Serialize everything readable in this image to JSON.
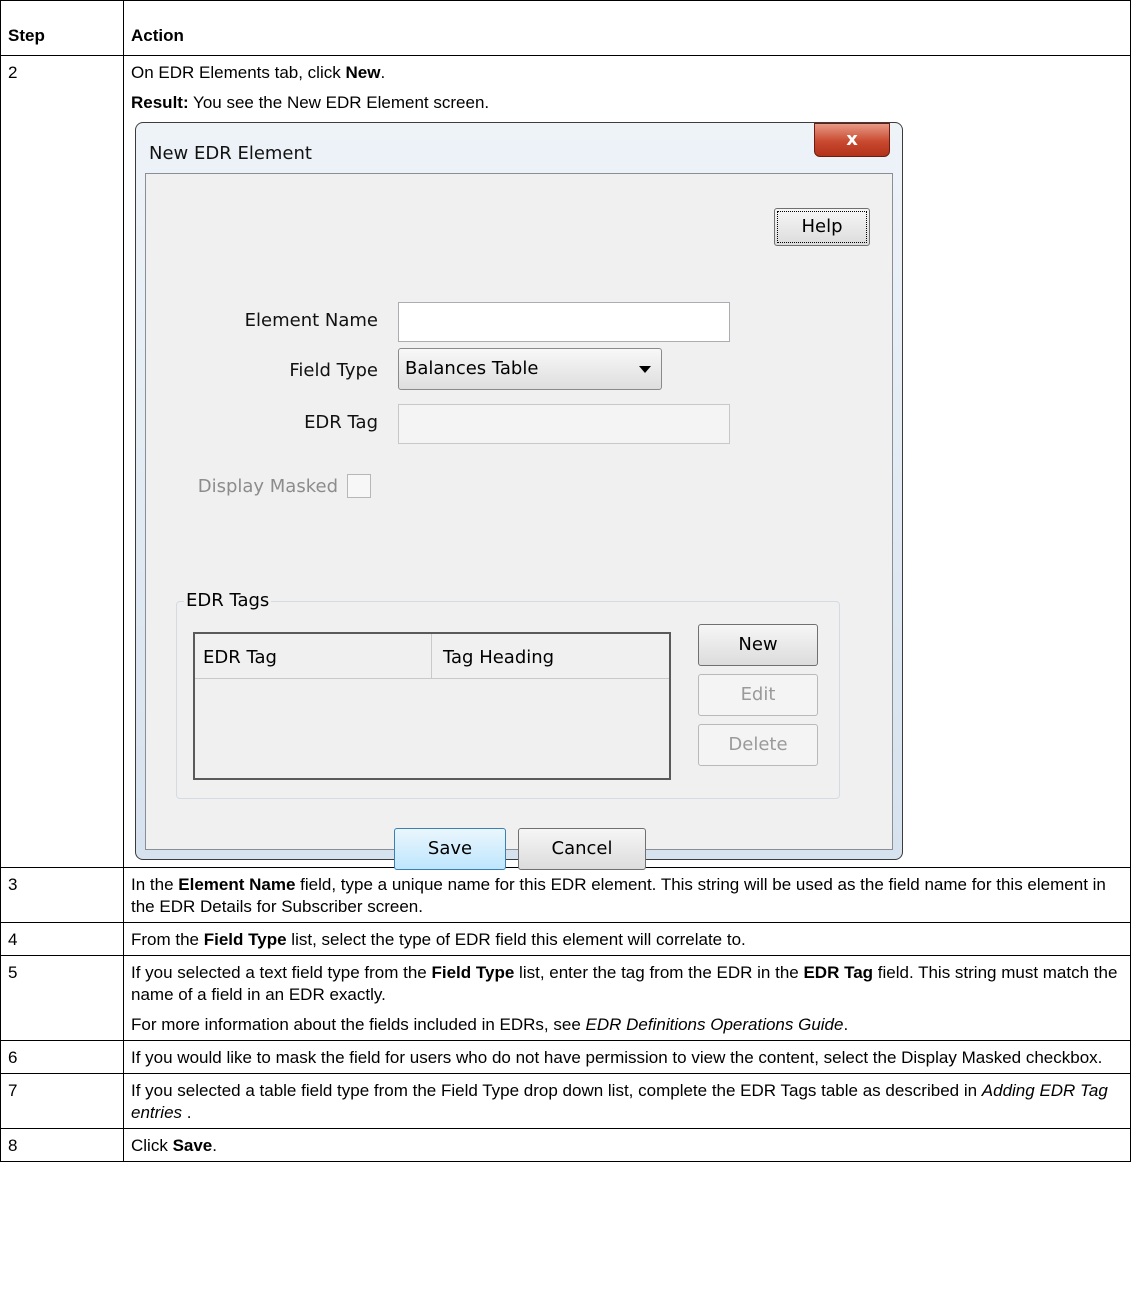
{
  "table": {
    "headers": [
      "Step",
      "Action"
    ],
    "rows": [
      {
        "step": "2",
        "parts": [
          [
            {
              "t": "On EDR Elements tab, click "
            },
            {
              "t": "New",
              "b": true
            },
            {
              "t": "."
            }
          ],
          [
            {
              "t": "Result:",
              "b": true
            },
            {
              "t": " You see the New EDR Element screen."
            }
          ]
        ],
        "has_dialog": true
      },
      {
        "step": "3",
        "parts": [
          [
            {
              "t": "In the "
            },
            {
              "t": "Element Name",
              "b": true
            },
            {
              "t": " field, type a unique name for this EDR element. This string will be used as the field name for this element in the EDR Details for Subscriber screen."
            }
          ]
        ]
      },
      {
        "step": "4",
        "parts": [
          [
            {
              "t": "From the "
            },
            {
              "t": "Field Type",
              "b": true
            },
            {
              "t": " list, select the type of EDR field this element will correlate to."
            }
          ]
        ]
      },
      {
        "step": "5",
        "parts": [
          [
            {
              "t": "If you selected a text field type from the "
            },
            {
              "t": "Field Type",
              "b": true
            },
            {
              "t": " list, enter the tag from the EDR in the "
            },
            {
              "t": "EDR Tag",
              "b": true
            },
            {
              "t": " field. This string must match the name of a field in an EDR exactly."
            }
          ],
          [
            {
              "t": "For more information about the fields included in EDRs, see "
            },
            {
              "t": "EDR Definitions Operations Guide",
              "i": true
            },
            {
              "t": "."
            }
          ]
        ]
      },
      {
        "step": "6",
        "parts": [
          [
            {
              "t": "If you would like to mask the field for users who do not have permission to view the content, select the Display Masked checkbox."
            }
          ]
        ]
      },
      {
        "step": "7",
        "parts": [
          [
            {
              "t": "If you selected a table field type from the Field Type drop down list, complete the EDR Tags table as described in "
            },
            {
              "t": "Adding EDR Tag entries",
              "i": true
            },
            {
              "t": " ."
            }
          ]
        ]
      },
      {
        "step": "8",
        "parts": [
          [
            {
              "t": "Click "
            },
            {
              "t": "Save",
              "b": true
            },
            {
              "t": "."
            }
          ]
        ]
      }
    ]
  },
  "dialog": {
    "title": "New EDR Element",
    "close_glyph": "x",
    "help_label": "Help",
    "element_name_label": "Element Name",
    "element_name_value": "",
    "field_type_label": "Field Type",
    "field_type_value": "Balances Table",
    "edr_tag_label": "EDR Tag",
    "edr_tag_value": "",
    "display_masked_label": "Display Masked",
    "display_masked_checked": false,
    "group_title": "EDR Tags",
    "columns": [
      "EDR Tag",
      "Tag Heading"
    ],
    "new_label": "New",
    "edit_label": "Edit",
    "delete_label": "Delete",
    "save_label": "Save",
    "cancel_label": "Cancel"
  }
}
